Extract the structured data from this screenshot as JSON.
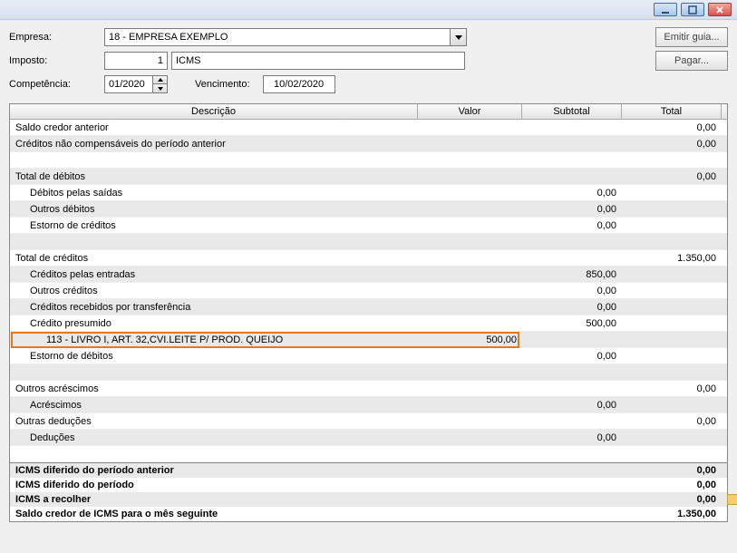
{
  "titlebar": {
    "minimize": "minimize",
    "maximize": "maximize",
    "close": "close"
  },
  "form": {
    "empresa_label": "Empresa:",
    "empresa_value": "18 - EMPRESA EXEMPLO",
    "imposto_label": "Imposto:",
    "imposto_code": "1",
    "imposto_name": "ICMS",
    "competencia_label": "Competência:",
    "competencia_value": "01/2020",
    "vencimento_label": "Vencimento:",
    "vencimento_value": "10/02/2020",
    "emitir_guia": "Emitir guia...",
    "pagar": "Pagar..."
  },
  "grid": {
    "headers": {
      "descricao": "Descrição",
      "valor": "Valor",
      "subtotal": "Subtotal",
      "total": "Total"
    },
    "rows": [
      {
        "desc": "Saldo credor anterior",
        "val": "",
        "sub": "",
        "tot": "0,00",
        "indent": 0,
        "alt": false
      },
      {
        "desc": "Créditos não compensáveis do período anterior",
        "val": "",
        "sub": "",
        "tot": "0,00",
        "indent": 0,
        "alt": true
      },
      {
        "desc": "",
        "val": "",
        "sub": "",
        "tot": "",
        "indent": 0,
        "alt": false
      },
      {
        "desc": "Total de débitos",
        "val": "",
        "sub": "",
        "tot": "0,00",
        "indent": 0,
        "alt": true
      },
      {
        "desc": "Débitos pelas saídas",
        "val": "",
        "sub": "0,00",
        "tot": "",
        "indent": 1,
        "alt": false
      },
      {
        "desc": "Outros débitos",
        "val": "",
        "sub": "0,00",
        "tot": "",
        "indent": 1,
        "alt": true
      },
      {
        "desc": "Estorno de créditos",
        "val": "",
        "sub": "0,00",
        "tot": "",
        "indent": 1,
        "alt": false
      },
      {
        "desc": "",
        "val": "",
        "sub": "",
        "tot": "",
        "indent": 0,
        "alt": true
      },
      {
        "desc": "Total de créditos",
        "val": "",
        "sub": "",
        "tot": "1.350,00",
        "indent": 0,
        "alt": false
      },
      {
        "desc": "Créditos pelas entradas",
        "val": "",
        "sub": "850,00",
        "tot": "",
        "indent": 1,
        "alt": true
      },
      {
        "desc": "Outros créditos",
        "val": "",
        "sub": "0,00",
        "tot": "",
        "indent": 1,
        "alt": false
      },
      {
        "desc": "Créditos recebidos por transferência",
        "val": "",
        "sub": "0,00",
        "tot": "",
        "indent": 1,
        "alt": true
      },
      {
        "desc": "Crédito presumido",
        "val": "",
        "sub": "500,00",
        "tot": "",
        "indent": 1,
        "alt": false
      },
      {
        "desc": "113 - LIVRO I, ART. 32,CVI.LEITE P/ PROD. QUEIJO",
        "val": "500,00",
        "sub": "",
        "tot": "",
        "indent": 2,
        "alt": true,
        "highlight": true
      },
      {
        "desc": "Estorno de débitos",
        "val": "",
        "sub": "0,00",
        "tot": "",
        "indent": 1,
        "alt": false
      },
      {
        "desc": "",
        "val": "",
        "sub": "",
        "tot": "",
        "indent": 0,
        "alt": true
      },
      {
        "desc": "Outros acréscimos",
        "val": "",
        "sub": "",
        "tot": "0,00",
        "indent": 0,
        "alt": false
      },
      {
        "desc": "Acréscimos",
        "val": "",
        "sub": "0,00",
        "tot": "",
        "indent": 1,
        "alt": true
      },
      {
        "desc": "Outras deduções",
        "val": "",
        "sub": "",
        "tot": "0,00",
        "indent": 0,
        "alt": false
      },
      {
        "desc": "Deduções",
        "val": "",
        "sub": "0,00",
        "tot": "",
        "indent": 1,
        "alt": true
      },
      {
        "desc": "",
        "val": "",
        "sub": "",
        "tot": "",
        "indent": 0,
        "alt": false
      }
    ]
  },
  "footer": [
    {
      "desc": "ICMS diferido do período anterior",
      "val": "0,00",
      "alt": true,
      "marker": false
    },
    {
      "desc": "ICMS diferido do período",
      "val": "0,00",
      "alt": false,
      "marker": false
    },
    {
      "desc": "ICMS a recolher",
      "val": "0,00",
      "alt": true,
      "marker": true
    },
    {
      "desc": "Saldo credor de ICMS para o mês seguinte",
      "val": "1.350,00",
      "alt": false,
      "marker": false
    }
  ]
}
